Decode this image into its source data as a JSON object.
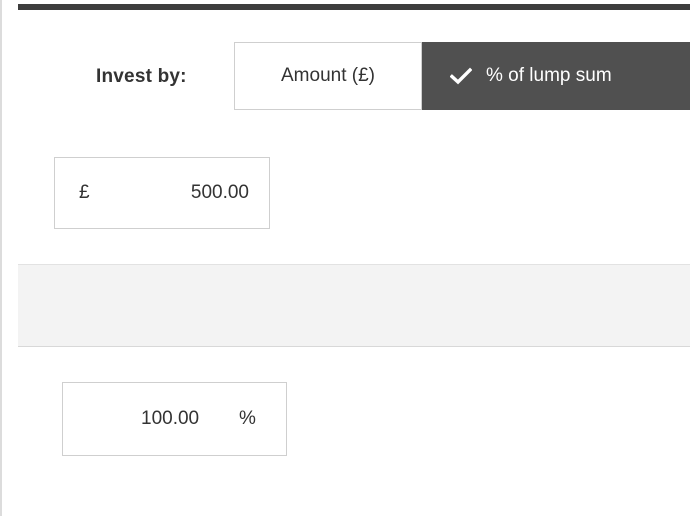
{
  "invest_by": {
    "label": "Invest by:",
    "options": [
      {
        "label": "Amount (£)",
        "selected": false
      },
      {
        "label": "% of lump sum",
        "selected": true
      }
    ],
    "selected_icon": "check-icon"
  },
  "amount_field": {
    "prefix": "£",
    "value": "500.00"
  },
  "percent_field": {
    "value": "100.00",
    "suffix": "%"
  },
  "colors": {
    "top_bar": "#3d3d3d",
    "selected_toggle": "#505050",
    "band": "#f3f3f3",
    "border": "#cfcfcf"
  }
}
